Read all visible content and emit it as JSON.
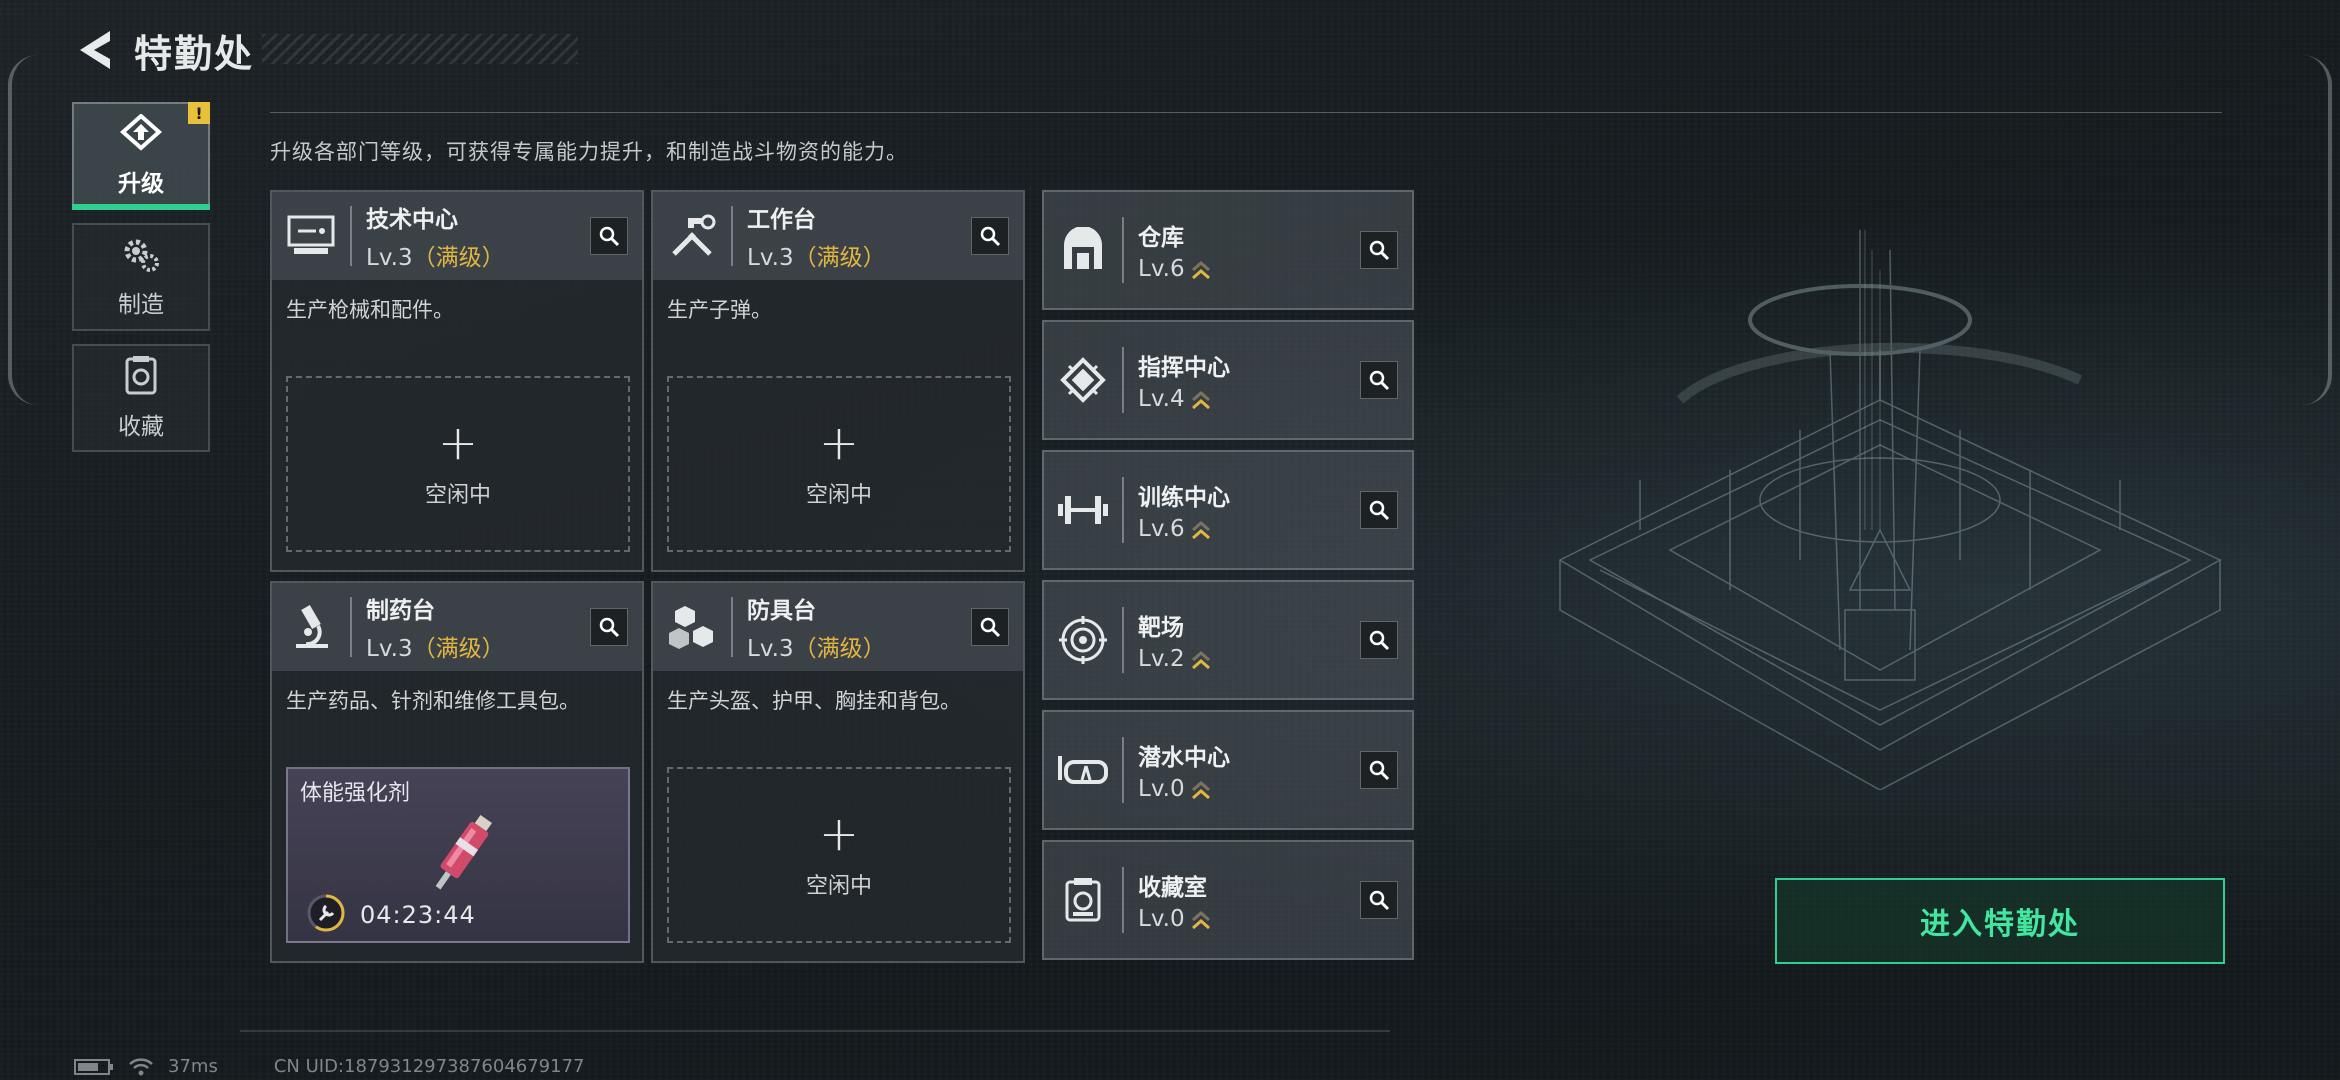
{
  "header": {
    "title": "特勤处"
  },
  "sidebar": {
    "items": [
      {
        "label": "升级",
        "icon": "upgrade-icon",
        "active": true,
        "badge": "!"
      },
      {
        "label": "制造",
        "icon": "gears-icon",
        "active": false
      },
      {
        "label": "收藏",
        "icon": "collection-icon",
        "active": false
      }
    ]
  },
  "description": "升级各部门等级，可获得专属能力提升，和制造战斗物资的能力。",
  "departments": [
    {
      "name": "技术中心",
      "level": "Lv.3",
      "level_extra": "（满级）",
      "desc": "生产枪械和配件。",
      "icon": "computer-icon",
      "slot": {
        "state": "idle",
        "label": "空闲中"
      }
    },
    {
      "name": "工作台",
      "level": "Lv.3",
      "level_extra": "（满级）",
      "desc": "生产子弹。",
      "icon": "tools-icon",
      "slot": {
        "state": "idle",
        "label": "空闲中"
      }
    },
    {
      "name": "制药台",
      "level": "Lv.3",
      "level_extra": "（满级）",
      "desc": "生产药品、针剂和维修工具包。",
      "icon": "microscope-icon",
      "slot": {
        "state": "crafting",
        "item": "体能强化剂",
        "time": "04:23:44",
        "progress": 0.6
      }
    },
    {
      "name": "防具台",
      "level": "Lv.3",
      "level_extra": "（满级）",
      "desc": "生产头盔、护甲、胸挂和背包。",
      "icon": "armor-cubes-icon",
      "slot": {
        "state": "idle",
        "label": "空闲中"
      }
    }
  ],
  "facilities": [
    {
      "name": "仓库",
      "level": "Lv.6",
      "icon": "warehouse-icon"
    },
    {
      "name": "指挥中心",
      "level": "Lv.4",
      "icon": "chip-icon"
    },
    {
      "name": "训练中心",
      "level": "Lv.6",
      "icon": "dumbbell-icon"
    },
    {
      "name": "靶场",
      "level": "Lv.2",
      "icon": "target-icon"
    },
    {
      "name": "潜水中心",
      "level": "Lv.0",
      "icon": "diving-mask-icon"
    },
    {
      "name": "收藏室",
      "level": "Lv.0",
      "icon": "collection-icon"
    }
  ],
  "enter_button": {
    "label": "进入特勤处"
  },
  "status": {
    "ping": "37ms",
    "uid": "CN UID:187931297387604679177"
  },
  "colors": {
    "accent_green": "#2fd08d",
    "gold": "#e2b640",
    "warning": "#e8c03a"
  }
}
